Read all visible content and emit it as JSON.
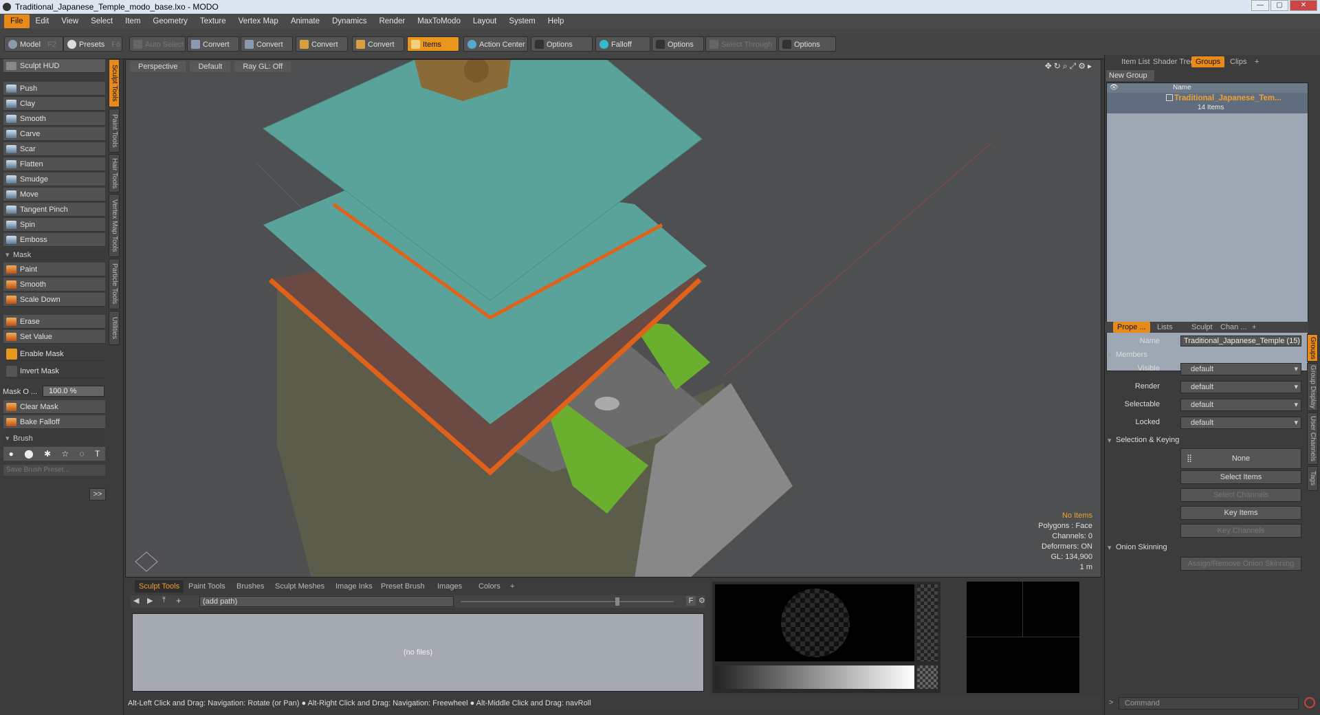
{
  "window": {
    "title": "Traditional_Japanese_Temple_modo_base.lxo - MODO"
  },
  "menubar": [
    "File",
    "Edit",
    "View",
    "Select",
    "Item",
    "Geometry",
    "Texture",
    "Vertex Map",
    "Animate",
    "Dynamics",
    "Render",
    "MaxToModo",
    "Layout",
    "System",
    "Help"
  ],
  "toolbar": {
    "model": "Model",
    "model_key": "F2",
    "presets": "Presets",
    "presets_key": "F6",
    "auto_select": "Auto Select",
    "convert1": "Convert",
    "convert2": "Convert",
    "convert3": "Convert",
    "convert4": "Convert",
    "items": "Items",
    "action_center": "Action Center",
    "options1": "Options",
    "falloff": "Falloff",
    "options2": "Options",
    "select_through": "Select Through",
    "options3": "Options"
  },
  "left": {
    "hud": "Sculpt HUD",
    "tools": [
      "Push",
      "Clay",
      "Smooth",
      "Carve",
      "Scar",
      "Flatten",
      "Smudge",
      "Move",
      "Tangent Pinch",
      "Spin",
      "Emboss"
    ],
    "mask_section": "Mask",
    "mask_tools": [
      "Paint",
      "Smooth",
      "Scale Down"
    ],
    "erase": "Erase",
    "set_value": "Set Value",
    "enable_mask": "Enable Mask",
    "invert_mask": "Invert Mask",
    "mask_opacity_label": "Mask O ...",
    "mask_opacity_value": "100.0 %",
    "clear_mask": "Clear Mask",
    "bake_falloff": "Bake Falloff",
    "brush_section": "Brush",
    "save_brush": "Save Brush Preset...",
    "expand": ">>"
  },
  "vtabs": [
    "Sculpt Tools",
    "Paint Tools",
    "Hair Tools",
    "Vertex Map Tools",
    "Particle Tools",
    "Utilities"
  ],
  "viewport": {
    "tabs": [
      "Perspective",
      "Default",
      "Ray GL: Off"
    ],
    "info": {
      "items": "No Items",
      "polygons": "Polygons : Face",
      "channels": "Channels: 0",
      "deformers": "Deformers: ON",
      "gl": "GL: 134,900",
      "scale": "1 m"
    }
  },
  "bottom": {
    "tabs": [
      "Sculpt Tools",
      "Paint Tools",
      "Brushes",
      "Sculpt Meshes",
      "Image Inks",
      "Preset Brush",
      "Images",
      "Colors",
      "+"
    ],
    "path": "(add path)",
    "f_button": "F",
    "no_files": "(no files)"
  },
  "status": "Alt-Left Click and Drag: Navigation: Rotate (or Pan) ● Alt-Right Click and Drag: Navigation: Freewheel ● Alt-Middle Click and Drag: navRoll",
  "right": {
    "tabs": [
      "Item List",
      "Shader Tree",
      "Groups",
      "Clips",
      "+"
    ],
    "new_group": "New Group",
    "col_name": "Name",
    "group_name": "Traditional_Japanese_Tem...",
    "group_count": "14 Items",
    "prop_tabs": [
      "Prope ...",
      "Lists",
      "Sculpt",
      "Chan ...",
      "+"
    ],
    "name_label": "Name",
    "name_value": "Traditional_Japanese_Temple (15)",
    "members": "Members",
    "props": [
      {
        "label": "Visible",
        "value": "default"
      },
      {
        "label": "Render",
        "value": "default"
      },
      {
        "label": "Selectable",
        "value": "default"
      },
      {
        "label": "Locked",
        "value": "default"
      }
    ],
    "selection_keying": "Selection & Keying",
    "none": "None",
    "select_items": "Select Items",
    "select_channels": "Select Channels",
    "key_items": "Key Items",
    "key_channels": "Key Channels",
    "onion": "Onion Skinning",
    "assign_onion": "Assign/Remove Onion Skinning",
    "command": "Command",
    "right_vtabs": [
      "Groups",
      "Group Display",
      "User Channels",
      "Tags"
    ]
  },
  "colors": {
    "accent": "#e88a1a",
    "roof": "#5aa39a",
    "railing": "#e0621a",
    "floor": "#6a4a42",
    "stone": "#5b5d4a",
    "grass": "#6ab02e"
  }
}
